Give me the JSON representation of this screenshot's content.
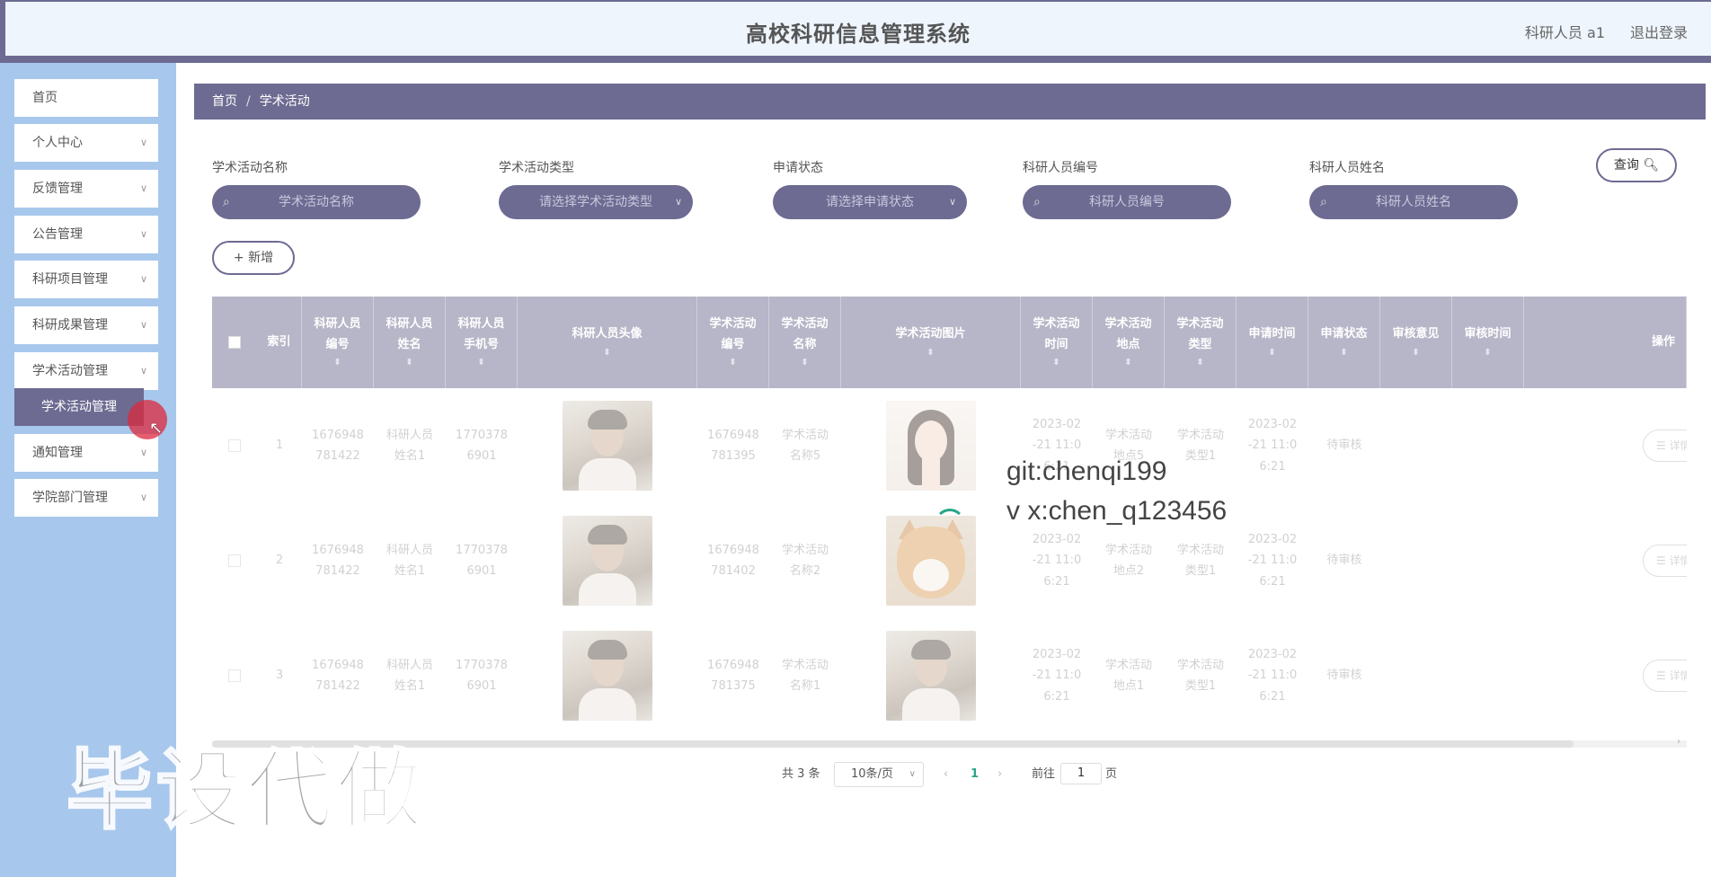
{
  "header": {
    "title": "高校科研信息管理系统",
    "user": "科研人员 a1",
    "logout": "退出登录"
  },
  "sidebar": {
    "items": [
      {
        "label": "首页",
        "has_chevron": false
      },
      {
        "label": "个人中心",
        "has_chevron": true
      },
      {
        "label": "反馈管理",
        "has_chevron": true
      },
      {
        "label": "公告管理",
        "has_chevron": true
      },
      {
        "label": "科研项目管理",
        "has_chevron": true
      },
      {
        "label": "科研成果管理",
        "has_chevron": true
      },
      {
        "label": "学术活动管理",
        "has_chevron": true
      },
      {
        "label": "通知管理",
        "has_chevron": true
      },
      {
        "label": "学院部门管理",
        "has_chevron": true
      }
    ],
    "active_submenu": "学术活动管理"
  },
  "breadcrumb": {
    "home": "首页",
    "separator": "/",
    "current": "学术活动"
  },
  "search": {
    "fields": [
      {
        "label": "学术活动名称",
        "placeholder": "学术活动名称",
        "type": "input"
      },
      {
        "label": "学术活动类型",
        "placeholder": "请选择学术活动类型",
        "type": "select"
      },
      {
        "label": "申请状态",
        "placeholder": "请选择申请状态",
        "type": "select"
      },
      {
        "label": "科研人员编号",
        "placeholder": "科研人员编号",
        "type": "input"
      },
      {
        "label": "科研人员姓名",
        "placeholder": "科研人员姓名",
        "type": "input"
      }
    ],
    "query_button": "查询",
    "add_button": "新增"
  },
  "table": {
    "columns": [
      {
        "key": "checkbox",
        "line1": "",
        "line2": ""
      },
      {
        "key": "index",
        "line1": "索引",
        "line2": ""
      },
      {
        "key": "staff_no",
        "line1": "科研人员",
        "line2": "编号"
      },
      {
        "key": "staff_name",
        "line1": "科研人员",
        "line2": "姓名"
      },
      {
        "key": "phone",
        "line1": "科研人员",
        "line2": "手机号"
      },
      {
        "key": "avatar",
        "line1": "科研人员头像",
        "line2": ""
      },
      {
        "key": "activity_no",
        "line1": "学术活动",
        "line2": "编号"
      },
      {
        "key": "activity_name",
        "line1": "学术活动",
        "line2": "名称"
      },
      {
        "key": "photo",
        "line1": "学术活动图片",
        "line2": ""
      },
      {
        "key": "activity_time",
        "line1": "学术活动",
        "line2": "时间"
      },
      {
        "key": "location",
        "line1": "学术活动",
        "line2": "地点"
      },
      {
        "key": "activity_type",
        "line1": "学术活动",
        "line2": "类型"
      },
      {
        "key": "apply_time",
        "line1": "申请时间",
        "line2": ""
      },
      {
        "key": "status",
        "line1": "申请状态",
        "line2": ""
      },
      {
        "key": "review_comment",
        "line1": "审核意见",
        "line2": ""
      },
      {
        "key": "review_time",
        "line1": "审核时间",
        "line2": ""
      },
      {
        "key": "actions",
        "line1": "操作",
        "line2": ""
      }
    ],
    "rows": [
      {
        "index": "1",
        "staff_no": [
          "1676948",
          "781422"
        ],
        "staff_name": [
          "科研人员",
          "姓名1"
        ],
        "phone": [
          "1770378",
          "6901"
        ],
        "avatar_icon": "man-photo",
        "activity_no": [
          "1676948",
          "781395"
        ],
        "activity_name": [
          "学术活动",
          "名称5"
        ],
        "photo_icon": "woman-photo",
        "activity_time": [
          "2023-02",
          "-21 11:0",
          "6:21"
        ],
        "location": [
          "学术活动",
          "地点5"
        ],
        "activity_type": [
          "学术活动",
          "类型1"
        ],
        "apply_time": [
          "2023-02",
          "-21 11:0",
          "6:21"
        ],
        "status": "待审核",
        "detail": "详情"
      },
      {
        "index": "2",
        "staff_no": [
          "1676948",
          "781422"
        ],
        "staff_name": [
          "科研人员",
          "姓名1"
        ],
        "phone": [
          "1770378",
          "6901"
        ],
        "avatar_icon": "man-photo",
        "activity_no": [
          "1676948",
          "781402"
        ],
        "activity_name": [
          "学术活动",
          "名称2"
        ],
        "photo_icon": "dog-photo",
        "activity_time": [
          "2023-02",
          "-21 11:0",
          "6:21"
        ],
        "location": [
          "学术活动",
          "地点2"
        ],
        "activity_type": [
          "学术活动",
          "类型1"
        ],
        "apply_time": [
          "2023-02",
          "-21 11:0",
          "6:21"
        ],
        "status": "待审核",
        "detail": "详情"
      },
      {
        "index": "3",
        "staff_no": [
          "1676948",
          "781422"
        ],
        "staff_name": [
          "科研人员",
          "姓名1"
        ],
        "phone": [
          "1770378",
          "6901"
        ],
        "avatar_icon": "man-photo",
        "activity_no": [
          "1676948",
          "781375"
        ],
        "activity_name": [
          "学术活动",
          "名称1"
        ],
        "photo_icon": "man-photo",
        "activity_time": [
          "2023-02",
          "-21 11:0",
          "6:21"
        ],
        "location": [
          "学术活动",
          "地点1"
        ],
        "activity_type": [
          "学术活动",
          "类型1"
        ],
        "apply_time": [
          "2023-02",
          "-21 11:0",
          "6:21"
        ],
        "status": "待审核",
        "detail": "详情"
      }
    ]
  },
  "pagination": {
    "total": "共 3 条",
    "page_size": "10条/页",
    "current_page": "1",
    "goto_prefix": "前往",
    "goto_value": "1",
    "goto_suffix": "页"
  },
  "overlay": {
    "line1": "git:chenqi199",
    "line2": "v x:chen_q123456",
    "watermark": "毕设代做"
  },
  "colors": {
    "primary": "#6d6b92",
    "sidebar_bg": "#a8c7ec",
    "header_bg": "#eef5fd",
    "table_header": "#b7b6c8",
    "click_indicator": "#dc283c"
  }
}
